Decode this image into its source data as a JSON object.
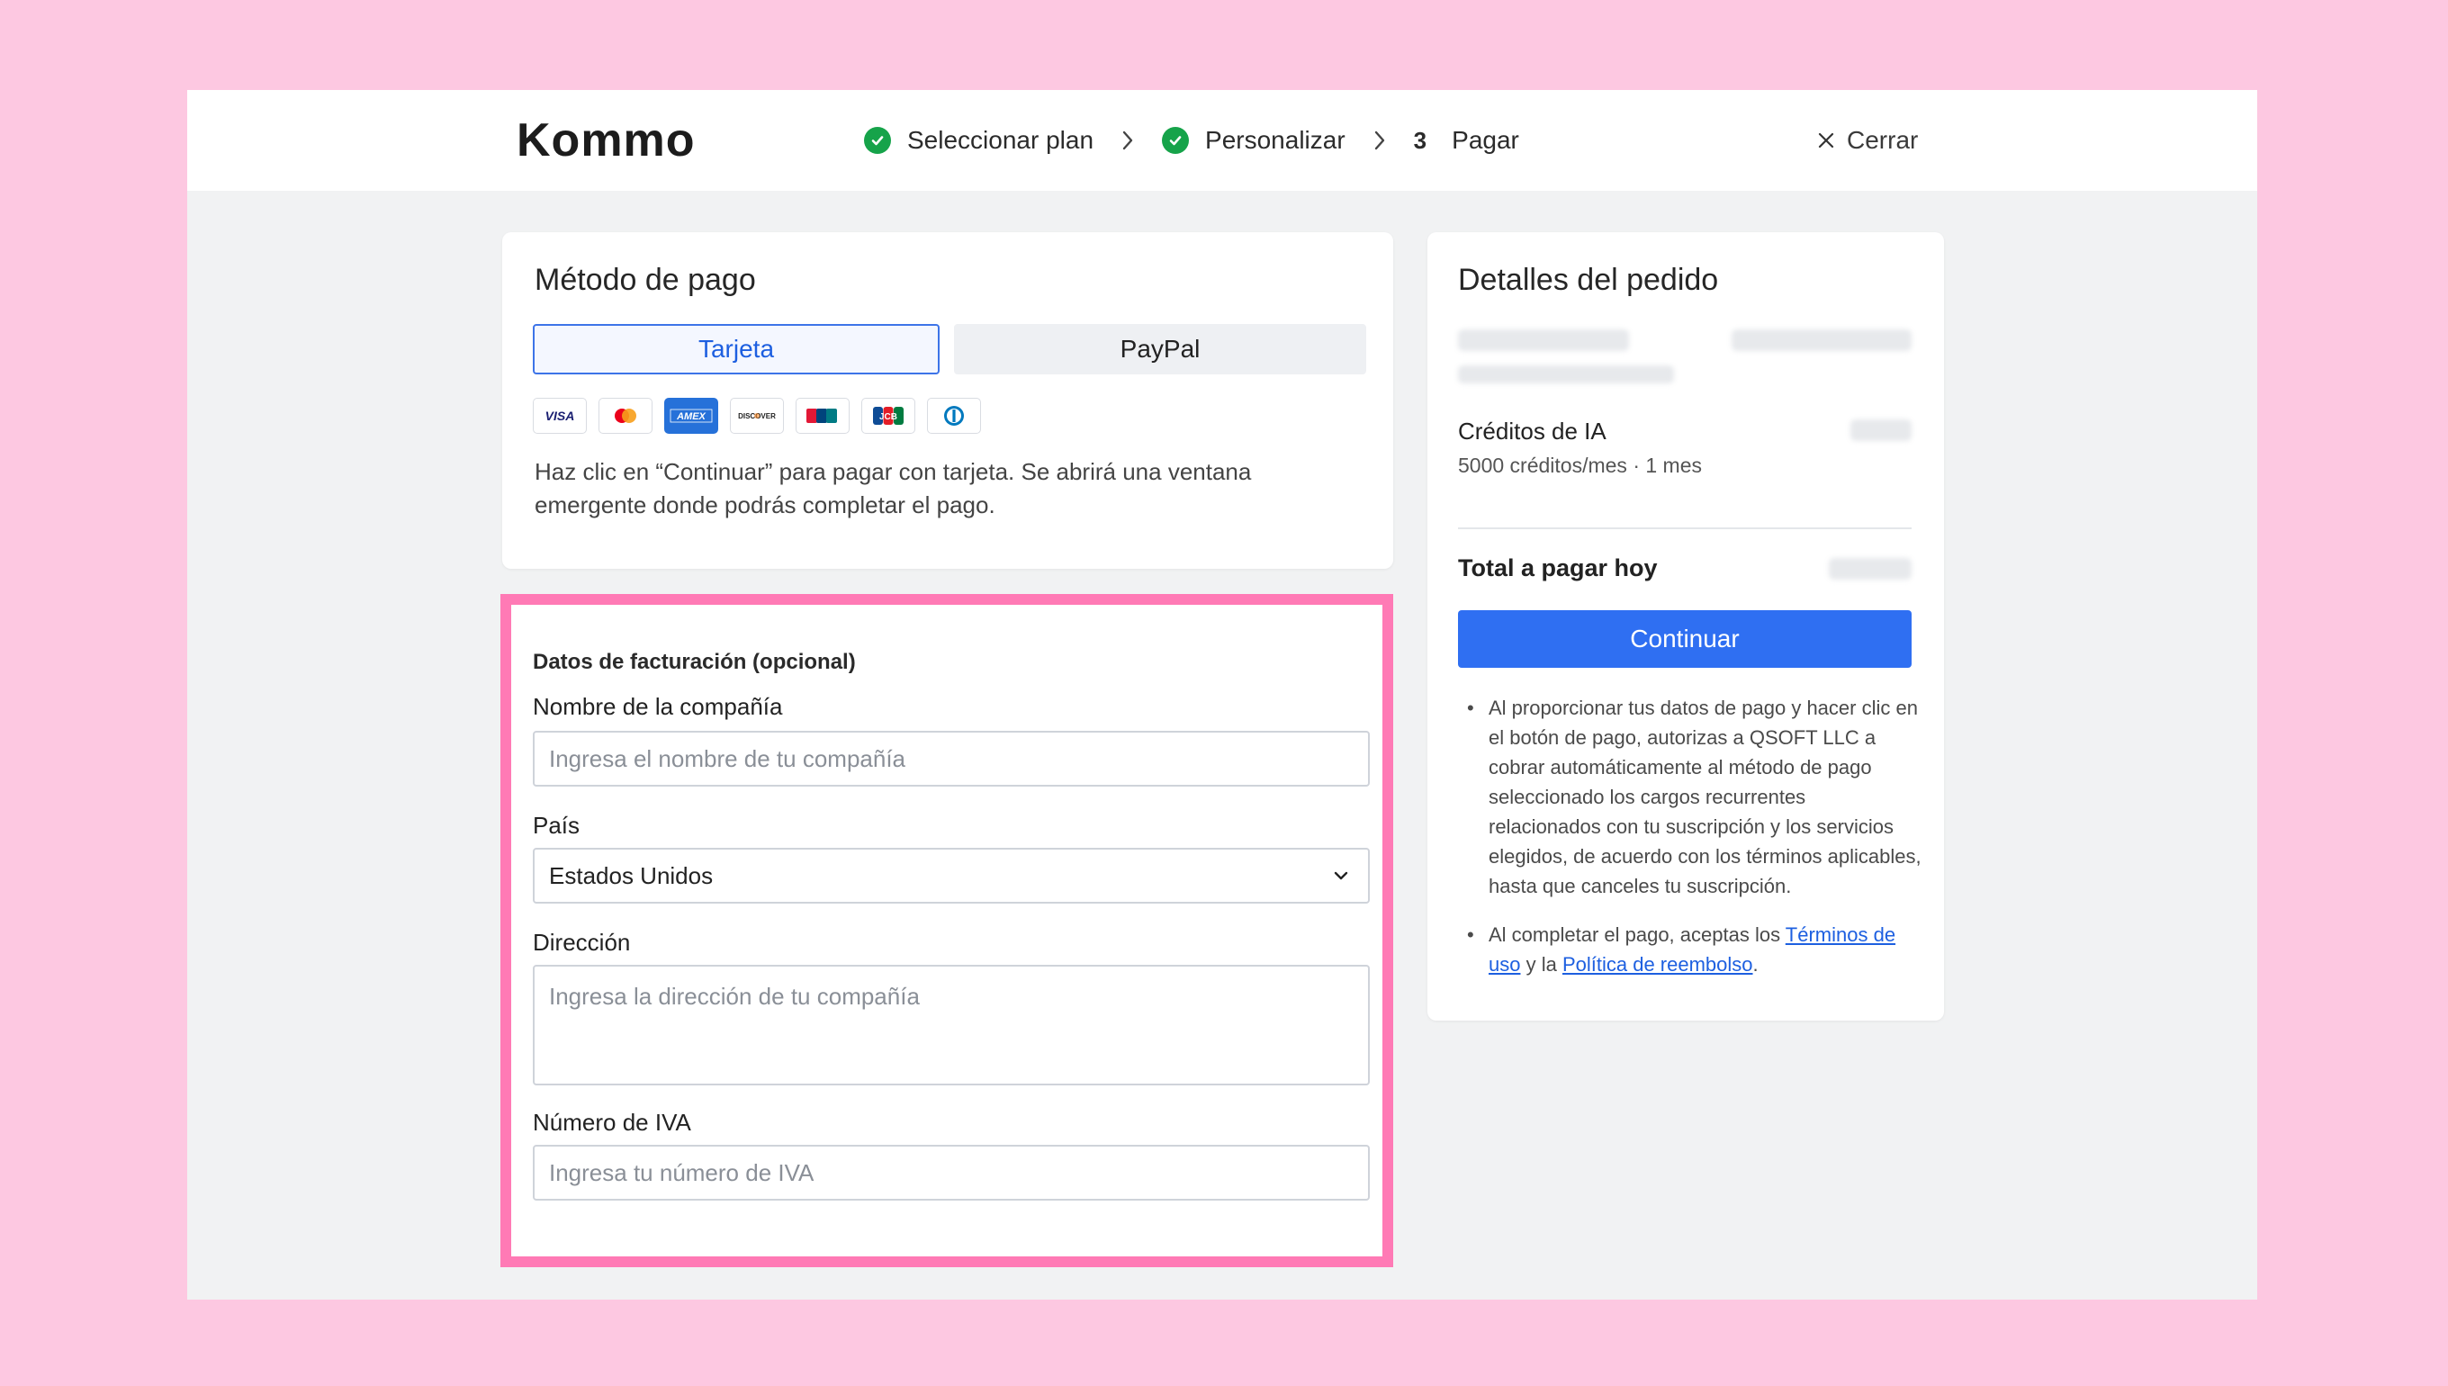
{
  "brand": {
    "logo_text": "Kommo"
  },
  "steps": [
    {
      "label": "Seleccionar plan",
      "state": "done"
    },
    {
      "label": "Personalizar",
      "state": "done"
    },
    {
      "number": "3",
      "label": "Pagar",
      "state": "current"
    }
  ],
  "header": {
    "close_label": "Cerrar"
  },
  "payment_method": {
    "title": "Método de pago",
    "tabs": [
      {
        "label": "Tarjeta",
        "active": true
      },
      {
        "label": "PayPal",
        "active": false
      }
    ],
    "card_brands": [
      "visa-icon",
      "mastercard-icon",
      "amex-icon",
      "discover-icon",
      "cup-icon",
      "jcb-icon",
      "diners-icon"
    ],
    "note": "Haz clic en “Continuar” para pagar con tarjeta. Se abrirá una ventana emergente donde podrás completar el pago."
  },
  "billing": {
    "title": "Datos de facturación (opcional)",
    "company_label": "Nombre de la compañía",
    "company_placeholder": "Ingresa el nombre de tu compañía",
    "country_label": "País",
    "country_value": "Estados Unidos",
    "address_label": "Dirección",
    "address_placeholder": "Ingresa la dirección de tu compañía",
    "vat_label": "Número de IVA",
    "vat_placeholder": "Ingresa tu número de IVA"
  },
  "order": {
    "title": "Detalles del pedido",
    "ai_credits_label": "Créditos de IA",
    "ai_credits_detail": "5000 créditos/mes · 1 mes",
    "total_label": "Total a pagar hoy",
    "continue_label": "Continuar",
    "legal_1": "Al proporcionar tus datos de pago y hacer clic en el botón de pago, autorizas a QSOFT LLC a cobrar automáticamente al método de pago seleccionado los cargos recurrentes relacionados con tu suscripción y los servicios elegidos, de acuerdo con los términos aplicables, hasta que canceles tu suscripción.",
    "legal_2_prefix": "Al completar el pago, aceptas los ",
    "terms_link": "Términos de uso",
    "legal_2_mid": " y la ",
    "refund_link": "Política de reembolso",
    "legal_2_suffix": "."
  },
  "colors": {
    "background": "#fdc8e1",
    "highlight": "#ff7ab5",
    "accent": "#2f6ff2",
    "success": "#16a34a"
  }
}
